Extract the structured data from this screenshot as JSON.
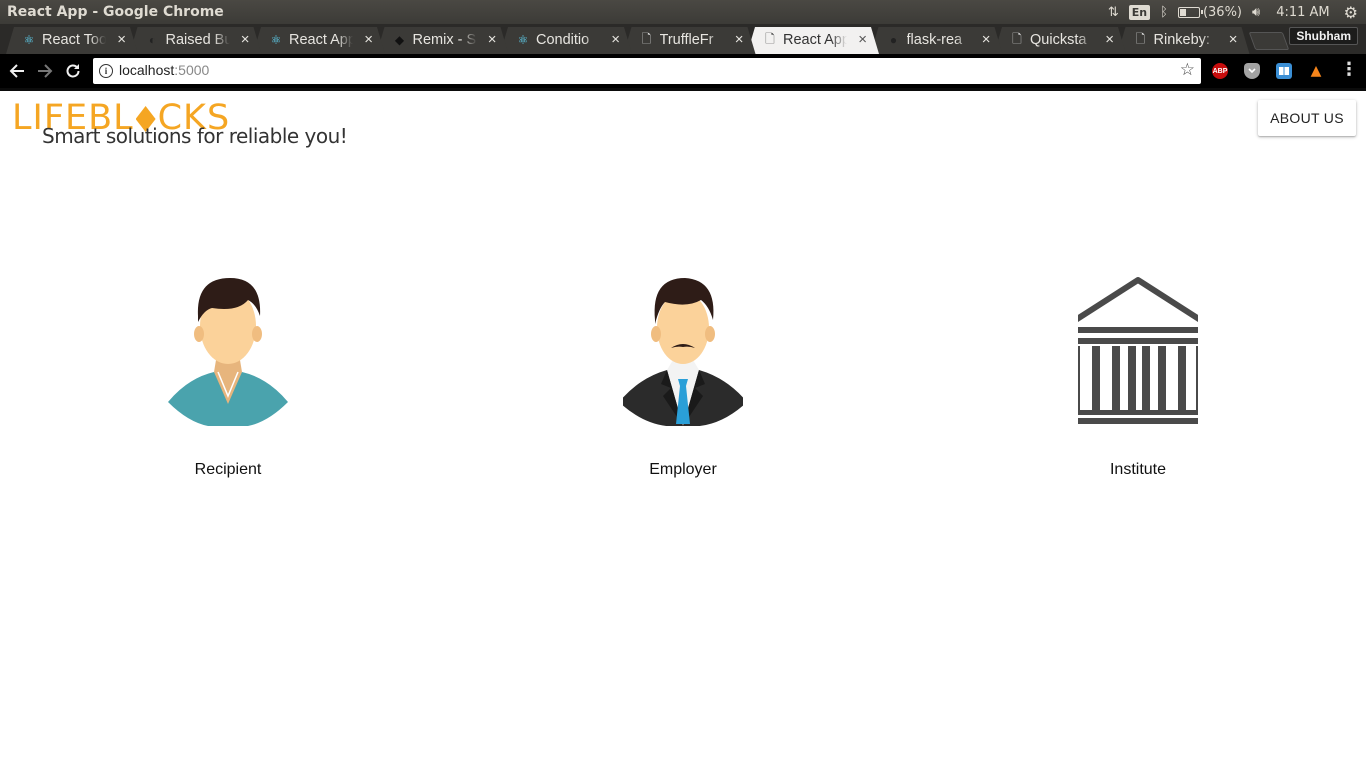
{
  "window": {
    "title": "React App - Google Chrome"
  },
  "system": {
    "battery": "(36%)",
    "battery_level": 0.36,
    "language": "En",
    "clock": "4:11 AM"
  },
  "tabs": [
    {
      "label": "React Too",
      "favicon": "react-icon"
    },
    {
      "label": "Raised Bu",
      "favicon": "material-icon"
    },
    {
      "label": "React App",
      "favicon": "react-icon"
    },
    {
      "label": "Remix - S",
      "favicon": "remix-icon"
    },
    {
      "label": "Conditio",
      "favicon": "react-icon"
    },
    {
      "label": "TruffleFr",
      "favicon": "page-icon"
    },
    {
      "label": "React App",
      "favicon": "page-icon",
      "active": true
    },
    {
      "label": "flask-rea",
      "favicon": "github-icon"
    },
    {
      "label": "Quicksta",
      "favicon": "page-icon"
    },
    {
      "label": "Rinkeby:",
      "favicon": "page-icon"
    }
  ],
  "profile": {
    "name": "Shubham"
  },
  "address_bar": {
    "host": "localhost",
    "port": ":5000"
  },
  "extensions": {
    "abp_label": "ABP"
  },
  "app": {
    "logo_text_left": "LIFEBL",
    "logo_text_right": "CKS",
    "tagline": "Smart solutions for reliable you!",
    "about_button": "ABOUT US",
    "brand_color": "#f5a623",
    "roles": [
      {
        "label": "Recipient",
        "icon": "recipient-avatar-icon"
      },
      {
        "label": "Employer",
        "icon": "employer-avatar-icon"
      },
      {
        "label": "Institute",
        "icon": "institute-building-icon"
      }
    ]
  }
}
